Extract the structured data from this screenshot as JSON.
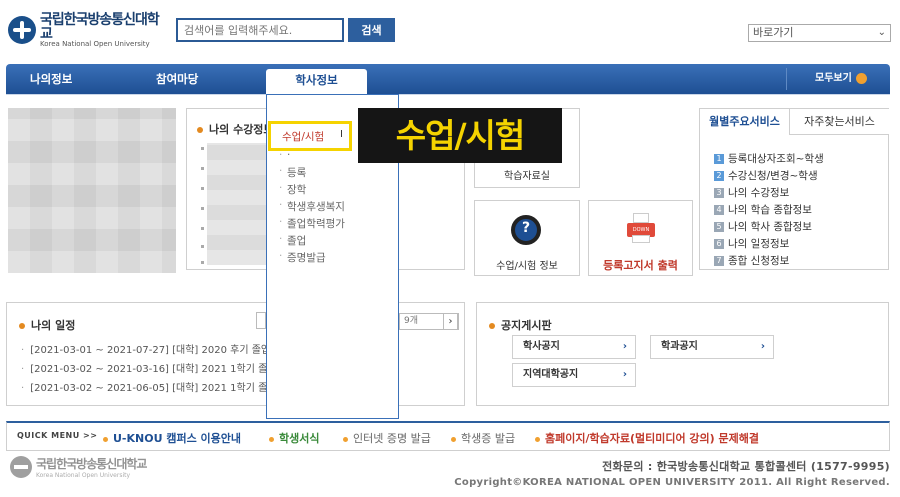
{
  "header": {
    "logo_ko": "국립한국방송통신대학교",
    "logo_en": "Korea National Open University",
    "search_placeholder": "검색어를 입력해주세요.",
    "search_button": "검색",
    "goto_select": "바로가기"
  },
  "nav": {
    "items": [
      "나의정보",
      "참여마당",
      "학사정보"
    ],
    "active": "학사정보",
    "more": "모두보기"
  },
  "course_box": {
    "title": "나의 수강정보"
  },
  "dropdown": {
    "items": [
      "수업/시험",
      "등록",
      "장학",
      "학생후생복지",
      "졸업학력평가",
      "졸업",
      "증명발급"
    ]
  },
  "callout": "수업/시험",
  "tiles": {
    "materials": "학습자료실",
    "class_exam": "수업/시험 정보",
    "reg_print": "등록고지서 출력",
    "printer_tag": "DOWN"
  },
  "services": {
    "tab_active": "월별주요서비스",
    "tab_inactive": "자주찾는서비스",
    "items": [
      {
        "num": "1",
        "label": "등록대상자조회~학생"
      },
      {
        "num": "2",
        "label": "수강신청/변경~학생"
      },
      {
        "num": "3",
        "label": "나의 수강정보"
      },
      {
        "num": "4",
        "label": "나의 학습 종합정보"
      },
      {
        "num": "5",
        "label": "나의 학사 종합정보"
      },
      {
        "num": "6",
        "label": "나의 일정정보"
      },
      {
        "num": "7",
        "label": "종합 신청정보"
      }
    ]
  },
  "schedule": {
    "title": "나의 일정",
    "pager": "9개",
    "rows": [
      "[2021-03-01 ~ 2021-07-27] [대학] 2020 후기 졸업",
      "[2021-03-02 ~ 2021-03-16] [대학] 2021 1학기 졸",
      "[2021-03-02 ~ 2021-06-05] [대학] 2021 1학기 졸"
    ]
  },
  "notice": {
    "title": "공지게시판",
    "buttons": [
      "학사공지",
      "학과공지",
      "지역대학공지"
    ]
  },
  "quick_menu": {
    "title": "QUICK MENU >>",
    "items": [
      {
        "label": "U-KNOU 캠퍼스 이용안내",
        "color": "#1e4f93"
      },
      {
        "label": "학생서식",
        "color": "#3a8a3a"
      },
      {
        "label": "인터넷 증명 발급",
        "color": "#666666"
      },
      {
        "label": "학생증 발급",
        "color": "#666666"
      },
      {
        "label": "홈페이지/학습자료(멀티미디어 강의) 문제해결",
        "color": "#c0392b"
      }
    ]
  },
  "footer": {
    "logo_ko": "국립한국방송통신대학교",
    "logo_en": "Korea National Open University",
    "phone": "전화문의 : 한국방송통신대학교 통합콜센터 (1577-9995)",
    "copyright": "Copyright©KOREA NATIONAL OPEN UNIVERSITY 2011. All Right Reserved."
  }
}
